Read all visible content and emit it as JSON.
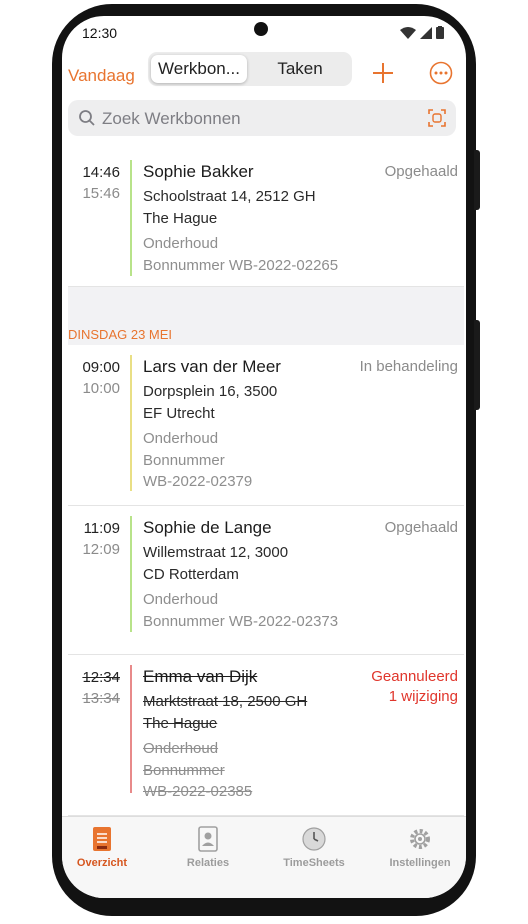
{
  "status_bar": {
    "time": "12:30"
  },
  "header": {
    "today_label": "Vandaag",
    "segments": [
      "Werkbon...",
      "Taken"
    ]
  },
  "search": {
    "placeholder": "Zoek Werkbonnen"
  },
  "colors": {
    "accent": "#e8742f",
    "cancelled": "#e0362c",
    "bar_green": "#b8e38a",
    "bar_yellow": "#e9df85",
    "bar_red": "#e88a8a"
  },
  "list": {
    "first": {
      "start": "14:46",
      "end": "15:46",
      "name": "Sophie Bakker",
      "address": [
        "Schoolstraat 14, 2512 GH",
        "The Hague"
      ],
      "meta": [
        "Onderhoud",
        "Bonnummer WB-2022-02265"
      ],
      "status": "Opgehaald"
    },
    "section_label": "DINSDAG 23 MEI",
    "items": [
      {
        "start": "09:00",
        "end": "10:00",
        "name": "Lars van der Meer",
        "address": [
          "Dorpsplein 16, 3500",
          "EF Utrecht"
        ],
        "meta": [
          "Onderhoud",
          "Bonnummer",
          "WB-2022-02379"
        ],
        "status": "In behandeling"
      },
      {
        "start": "11:09",
        "end": "12:09",
        "name": "Sophie de Lange",
        "address": [
          "Willemstraat 12, 3000",
          "CD Rotterdam"
        ],
        "meta": [
          "Onderhoud",
          "Bonnummer WB-2022-02373"
        ],
        "status": "Opgehaald"
      },
      {
        "start": "12:34",
        "end": "13:34",
        "name": "Emma van Dijk",
        "address": [
          "Marktstraat 18, 2500 GH",
          "The Hague"
        ],
        "meta": [
          "Onderhoud",
          "Bonnummer",
          "WB-2022-02385"
        ],
        "status": [
          "Geannuleerd",
          "1 wijziging"
        ]
      }
    ]
  },
  "tabbar": {
    "tabs": [
      "Overzicht",
      "Relaties",
      "TimeSheets",
      "Instellingen"
    ],
    "active": "Overzicht"
  }
}
